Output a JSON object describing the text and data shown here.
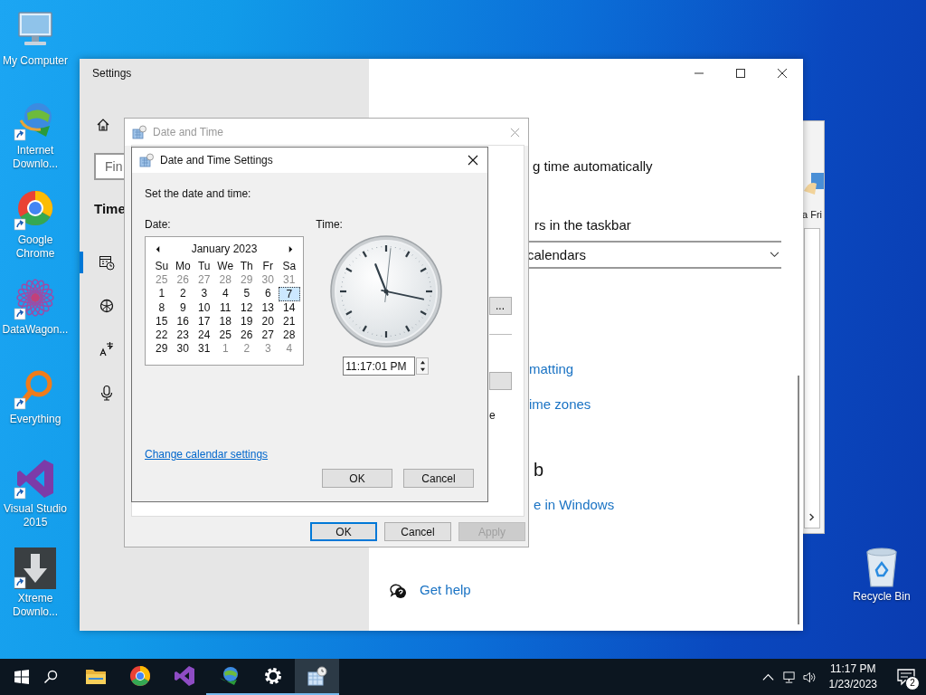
{
  "desktop_icons": [
    {
      "kind": "computer",
      "label": "My Computer"
    },
    {
      "kind": "idm",
      "label": "Internet Downlo..."
    },
    {
      "kind": "chrome",
      "label": "Google Chrome"
    },
    {
      "kind": "datawagon",
      "label": "DataWagon..."
    },
    {
      "kind": "everything",
      "label": "Everything"
    },
    {
      "kind": "vs",
      "label": "Visual Studio 2015"
    },
    {
      "kind": "xtreme",
      "label": "Xtreme Downlo..."
    }
  ],
  "recycle_bin": {
    "label": "Recycle Bin"
  },
  "settings": {
    "title": "Settings",
    "search": {
      "placeholder": "Fin"
    },
    "section": "Time",
    "nav": [
      {
        "kind": "calendar",
        "selected": true
      },
      {
        "kind": "globe",
        "selected": false
      },
      {
        "kind": "language",
        "selected": false
      },
      {
        "kind": "mic",
        "selected": false
      }
    ],
    "content": {
      "sync_text": "g time automatically",
      "taskbar_text": "rs in the taskbar",
      "calendar_dropdown": "calendars",
      "links": [
        "matting",
        "ime zones"
      ],
      "heading": "b",
      "web_link": "e in Windows",
      "help_link": "Get help"
    }
  },
  "back_window": {
    "label": "a Fri"
  },
  "date_time_dialog": {
    "title": "Date and Time",
    "change_button": "...",
    "text_fragment": "e",
    "buttons": [
      {
        "label": "OK",
        "kind": "default",
        "disabled": false
      },
      {
        "label": "Cancel",
        "kind": "normal",
        "disabled": false
      },
      {
        "label": "Apply",
        "kind": "normal",
        "disabled": true
      }
    ]
  },
  "settings_dialog": {
    "title": "Date and Time Settings",
    "prompt": "Set the date and time:",
    "date_label": "Date:",
    "time_label": "Time:",
    "month": "January 2023",
    "weekdays": [
      "Su",
      "Mo",
      "Tu",
      "We",
      "Th",
      "Fr",
      "Sa"
    ],
    "weeks": [
      [
        {
          "day": "25",
          "muted": true,
          "selected": false
        },
        {
          "day": "26",
          "muted": true,
          "selected": false
        },
        {
          "day": "27",
          "muted": true,
          "selected": false
        },
        {
          "day": "28",
          "muted": true,
          "selected": false
        },
        {
          "day": "29",
          "muted": true,
          "selected": false
        },
        {
          "day": "30",
          "muted": true,
          "selected": false
        },
        {
          "day": "31",
          "muted": true,
          "selected": false
        }
      ],
      [
        {
          "day": "1",
          "muted": false,
          "selected": false
        },
        {
          "day": "2",
          "muted": false,
          "selected": false
        },
        {
          "day": "3",
          "muted": false,
          "selected": false
        },
        {
          "day": "4",
          "muted": false,
          "selected": false
        },
        {
          "day": "5",
          "muted": false,
          "selected": false
        },
        {
          "day": "6",
          "muted": false,
          "selected": false
        },
        {
          "day": "7",
          "muted": false,
          "selected": true
        }
      ],
      [
        {
          "day": "8",
          "muted": false,
          "selected": false
        },
        {
          "day": "9",
          "muted": false,
          "selected": false
        },
        {
          "day": "10",
          "muted": false,
          "selected": false
        },
        {
          "day": "11",
          "muted": false,
          "selected": false
        },
        {
          "day": "12",
          "muted": false,
          "selected": false
        },
        {
          "day": "13",
          "muted": false,
          "selected": false
        },
        {
          "day": "14",
          "muted": false,
          "selected": false
        }
      ],
      [
        {
          "day": "15",
          "muted": false,
          "selected": false
        },
        {
          "day": "16",
          "muted": false,
          "selected": false
        },
        {
          "day": "17",
          "muted": false,
          "selected": false
        },
        {
          "day": "18",
          "muted": false,
          "selected": false
        },
        {
          "day": "19",
          "muted": false,
          "selected": false
        },
        {
          "day": "20",
          "muted": false,
          "selected": false
        },
        {
          "day": "21",
          "muted": false,
          "selected": false
        }
      ],
      [
        {
          "day": "22",
          "muted": false,
          "selected": false
        },
        {
          "day": "23",
          "muted": false,
          "selected": false
        },
        {
          "day": "24",
          "muted": false,
          "selected": false
        },
        {
          "day": "25",
          "muted": false,
          "selected": false
        },
        {
          "day": "26",
          "muted": false,
          "selected": false
        },
        {
          "day": "27",
          "muted": false,
          "selected": false
        },
        {
          "day": "28",
          "muted": false,
          "selected": false
        }
      ],
      [
        {
          "day": "29",
          "muted": false,
          "selected": false
        },
        {
          "day": "30",
          "muted": false,
          "selected": false
        },
        {
          "day": "31",
          "muted": false,
          "selected": false
        },
        {
          "day": "1",
          "muted": true,
          "selected": false
        },
        {
          "day": "2",
          "muted": true,
          "selected": false
        },
        {
          "day": "3",
          "muted": true,
          "selected": false
        },
        {
          "day": "4",
          "muted": true,
          "selected": false
        }
      ]
    ],
    "time": "11:17:01 PM",
    "link": "Change calendar settings",
    "buttons": [
      "OK",
      "Cancel"
    ]
  },
  "taskbar": {
    "apps": [
      {
        "kind": "explorer",
        "running": false,
        "selected": false
      },
      {
        "kind": "chrome",
        "running": false,
        "selected": false
      },
      {
        "kind": "vs",
        "running": false,
        "selected": false
      },
      {
        "kind": "idm",
        "running": true,
        "selected": false
      },
      {
        "kind": "settings",
        "running": true,
        "selected": false
      },
      {
        "kind": "datetime",
        "running": true,
        "selected": true
      }
    ],
    "clock_time": "11:17 PM",
    "clock_date": "1/23/2023",
    "notifications": "2"
  }
}
